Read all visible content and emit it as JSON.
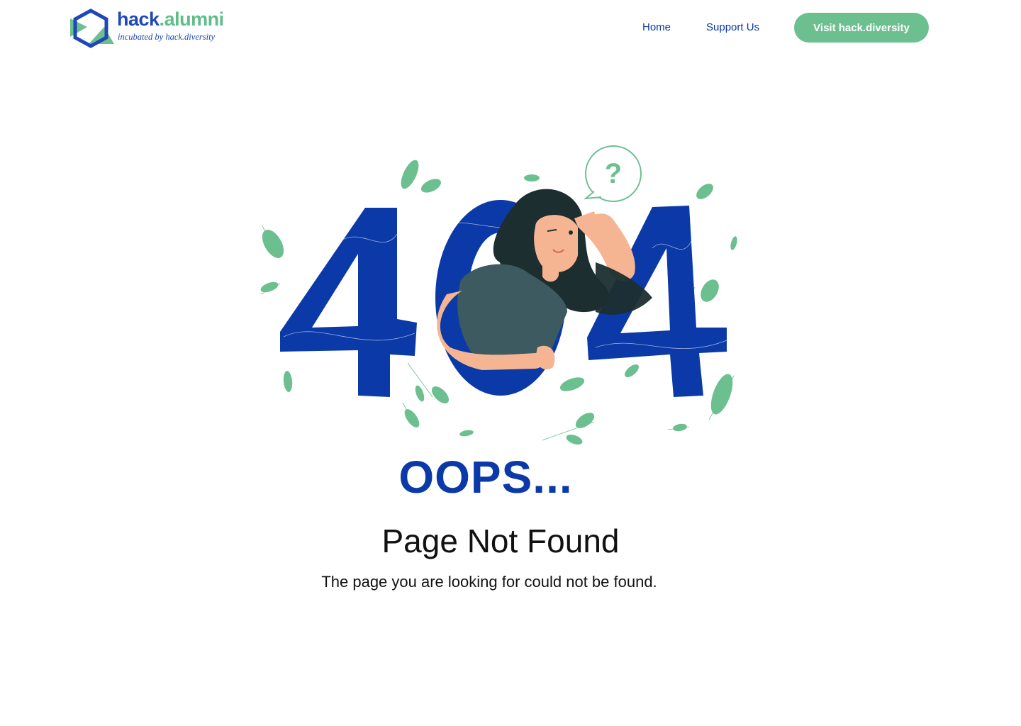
{
  "header": {
    "logo": {
      "brand_prefix": "hack",
      "brand_dot": ".",
      "brand_suffix": "alumni",
      "tagline": "incubated by hack.diversity"
    },
    "nav": {
      "home": "Home",
      "support": "Support Us",
      "visit_button": "Visit hack.diversity"
    }
  },
  "illustration": {
    "digits": [
      "4",
      "0",
      "4"
    ],
    "speech_bubble": "?"
  },
  "main": {
    "oops": "OOPS...",
    "title": "Page Not Found",
    "message": "The page you are looking for could not be found."
  },
  "colors": {
    "brand_blue": "#0b3aa8",
    "accent_green": "#6cc090",
    "leaf_green": "#6cc090"
  }
}
